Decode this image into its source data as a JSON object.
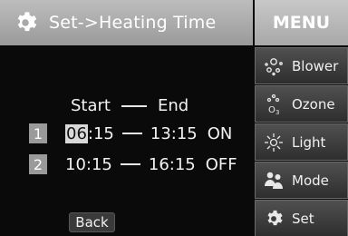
{
  "header": {
    "title": "Set->Heating Time",
    "icon": "gear-icon"
  },
  "menu": {
    "title": "MENU",
    "items": [
      {
        "label": "Blower",
        "icon": "blower-icon"
      },
      {
        "label": "Ozone",
        "icon": "ozone-icon"
      },
      {
        "label": "Light",
        "icon": "light-icon"
      },
      {
        "label": "Mode",
        "icon": "mode-icon"
      },
      {
        "label": "Set",
        "icon": "gear-icon"
      }
    ]
  },
  "schedule": {
    "start_label": "Start",
    "end_label": "End",
    "rows": [
      {
        "index": "1",
        "start_hour": "06",
        "start_min": ":15",
        "end": "13:15",
        "state": "ON"
      },
      {
        "index": "2",
        "start_hour": "10",
        "start_min": ":15",
        "end": "16:15",
        "state": "OFF"
      }
    ]
  },
  "back_label": "Back"
}
